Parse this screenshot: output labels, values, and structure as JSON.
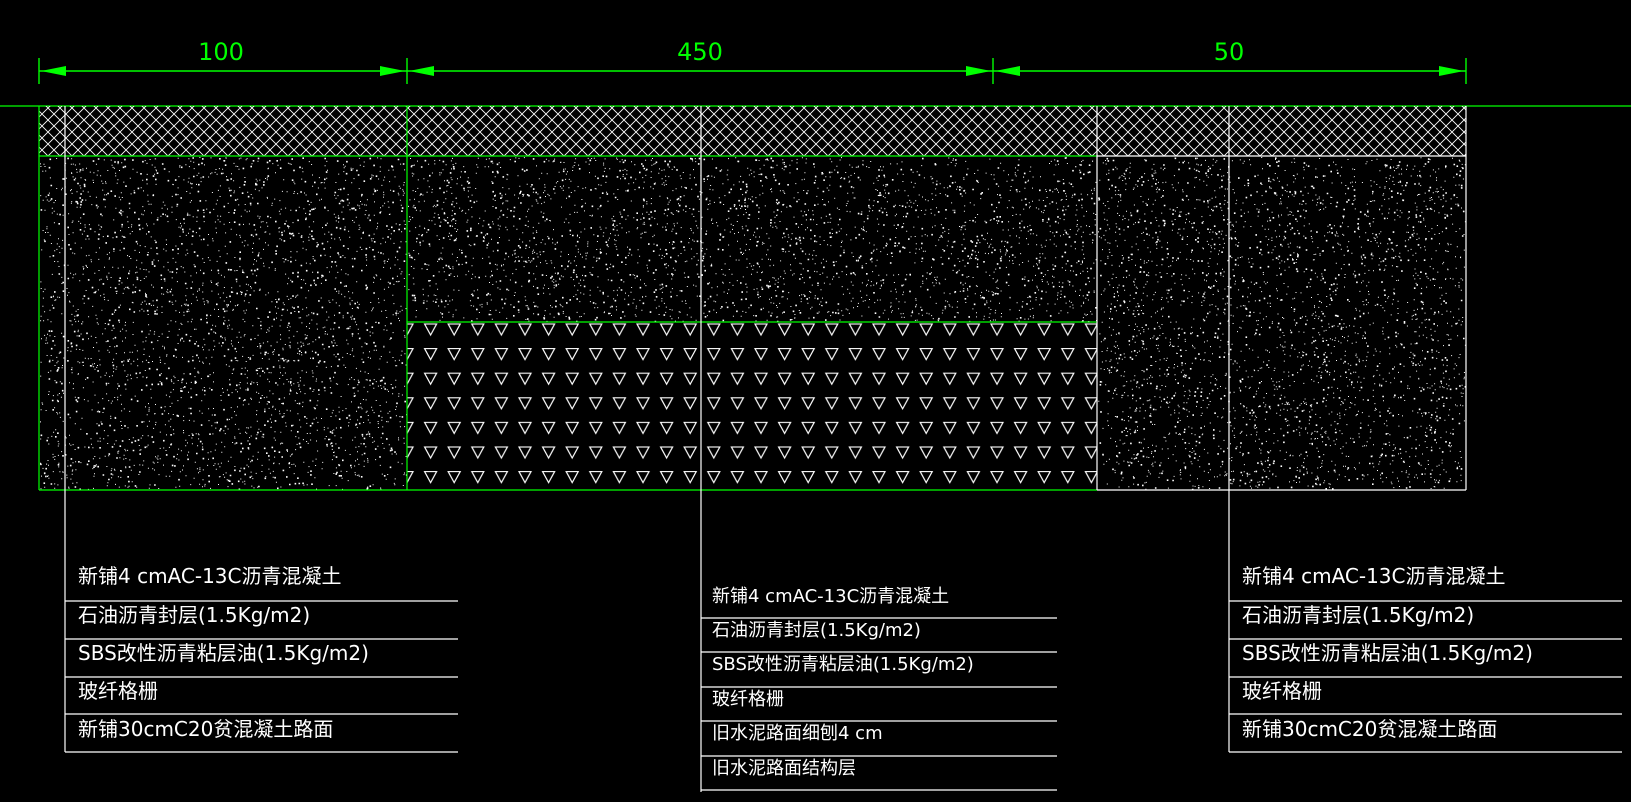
{
  "colors": {
    "background": "#000000",
    "dimension": "#00ff00",
    "outline": "#00ff00",
    "linework": "#ffffff",
    "speckle": "#ffffff"
  },
  "dimensions": [
    {
      "id": "left",
      "label": "100"
    },
    {
      "id": "middle",
      "label": "450"
    },
    {
      "id": "right",
      "label": "50"
    }
  ],
  "layer_patterns": {
    "surface": "crosshatch",
    "base": "speckled-concrete",
    "old_pavement": "inverted-triangles"
  },
  "callouts": {
    "left": [
      "新铺4 cmAC-13C沥青混凝土",
      "石油沥青封层(1.5Kg/m2)",
      "SBS改性沥青粘层油(1.5Kg/m2)",
      "玻纤格栅",
      "新铺30cmC20贫混凝土路面"
    ],
    "middle": [
      "新铺4 cmAC-13C沥青混凝土",
      "石油沥青封层(1.5Kg/m2)",
      "SBS改性沥青粘层油(1.5Kg/m2)",
      "玻纤格栅",
      "旧水泥路面细刨4 cm",
      "旧水泥路面结构层"
    ],
    "right": [
      "新铺4 cmAC-13C沥青混凝土",
      "石油沥青封层(1.5Kg/m2)",
      "SBS改性沥青粘层油(1.5Kg/m2)",
      "玻纤格栅",
      "新铺30cmC20贫混凝土路面"
    ]
  }
}
